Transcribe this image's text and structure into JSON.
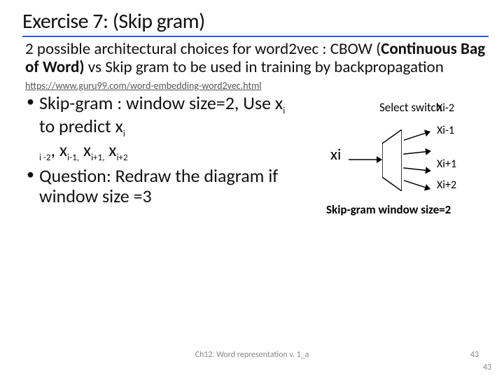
{
  "title": "Exercise 7: (Skip gram)",
  "intro_pre": "2 possible architectural choices for word2vec : CBOW (",
  "intro_bold": "Continuous Bag of Word)",
  "intro_post": " vs Skip gram to be used in training by backpropagation",
  "link": "https://www.guru99.com/word-embedding-word2vec.html",
  "bullet1_a": "Skip-gram : window size=2, Use x",
  "bullet1_b": " to predict x",
  "bullet1_tail_a": ", x",
  "bullet1_tail_b": " x",
  "bullet1_tail_c": " x",
  "sub_i": "i",
  "sub_im2": "i -2",
  "sub_im1": "i-1,",
  "sub_ip1": "i+1,",
  "sub_ip2": "i+2",
  "bullet2": "Question: Redraw the diagram if window size =3",
  "diagram": {
    "xi": "xi",
    "select": "Select switch",
    "outs": [
      "Xi-2",
      "Xi-1",
      "Xi+1",
      "Xi+2"
    ],
    "caption": "Skip-gram window size=2"
  },
  "footer": "Ch12. Word  representation v. 1_a",
  "page_a": "43",
  "page_b": "43"
}
